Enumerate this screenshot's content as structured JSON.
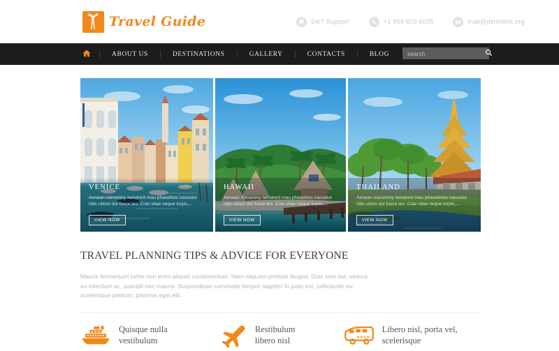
{
  "header": {
    "logo": {
      "icon": "palm-tree-icon",
      "text": "Travel Guide",
      "color": "#F0891C"
    },
    "contacts": [
      {
        "icon": "chat-bubble-icon",
        "label": "24/7 Support"
      },
      {
        "icon": "phone-icon",
        "label": "+1 959 603 6035"
      },
      {
        "icon": "envelope-icon",
        "label": "mail@demolink.org"
      }
    ]
  },
  "nav": {
    "home_icon": "home-icon",
    "items": [
      {
        "label": "ABOUT US"
      },
      {
        "label": "DESTINATIONS"
      },
      {
        "label": "GALLERY"
      },
      {
        "label": "CONTACTS"
      },
      {
        "label": "BLOG"
      }
    ],
    "search": {
      "placeholder": "search",
      "value": "",
      "icon": "search-icon"
    }
  },
  "gallery": {
    "cards": [
      {
        "title": "VENICE",
        "text": "Aenean nonummy hendrerit mau phasellres nascetur ridic ukism dui fusce leo. Cras vitae neque turpis,...",
        "button": "VIEW NOW"
      },
      {
        "title": "HAWAII",
        "text": "Aenean nonummy hendrerit mau phasellres nascetur ridic ukism dui fusce leo. Cras vitae neque turpis,...",
        "button": "VIEW NOW"
      },
      {
        "title": "THAILAND",
        "text": "Aenean nonummy hendrerit mau phasellntes nascetur ridic ukom dui fusce leo. Cras vitae neque turpis,...",
        "button": "VIEW NOW"
      }
    ]
  },
  "article": {
    "heading": "TRAVEL PLANNING TIPS & ADVICE FOR EVERYONE",
    "paragraph": "Mauris fermentum tortor non enim aliquet condimentum. Nam aliquam pretium feugiat. Duis sem est, viverra eu interdum ac, suscipit nec mauris. Suspendisse commodo tempor sagittis! In justo est, sollicitudin eu scelerisque pretium, placerat eget elit."
  },
  "features": [
    {
      "icon": "cruise-ship-icon",
      "line1": "Quisque nulla",
      "line2": "vestibulum"
    },
    {
      "icon": "airplane-icon",
      "line1": "Restibulum",
      "line2": "libero nisl"
    },
    {
      "icon": "bus-icon",
      "line1": "Libero nisl, porta vel,",
      "line2": "scelerisque"
    }
  ]
}
